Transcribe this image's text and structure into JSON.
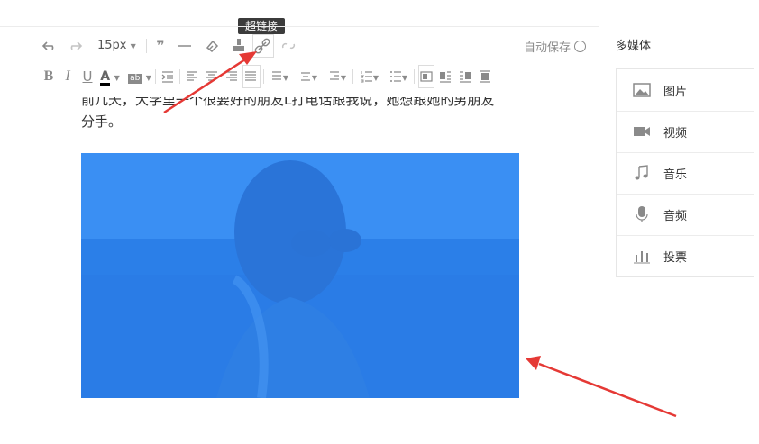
{
  "tooltip": "超链接",
  "toolbar": {
    "font_size": "15px",
    "autosave": "自动保存"
  },
  "content": {
    "line1": "前几天，大学里一个很要好的朋友L打电话跟我说，她想跟她的男朋友",
    "line2": "分手。"
  },
  "sidebar": {
    "title": "多媒体",
    "items": [
      {
        "label": "图片",
        "icon": "image-icon"
      },
      {
        "label": "视频",
        "icon": "video-icon"
      },
      {
        "label": "音乐",
        "icon": "music-icon"
      },
      {
        "label": "音频",
        "icon": "microphone-icon"
      },
      {
        "label": "投票",
        "icon": "vote-icon"
      }
    ]
  },
  "colors": {
    "image_tint": "#2f86f0",
    "annotation_arrow": "#e53935",
    "toolbar_icon": "#8a8a8a"
  }
}
